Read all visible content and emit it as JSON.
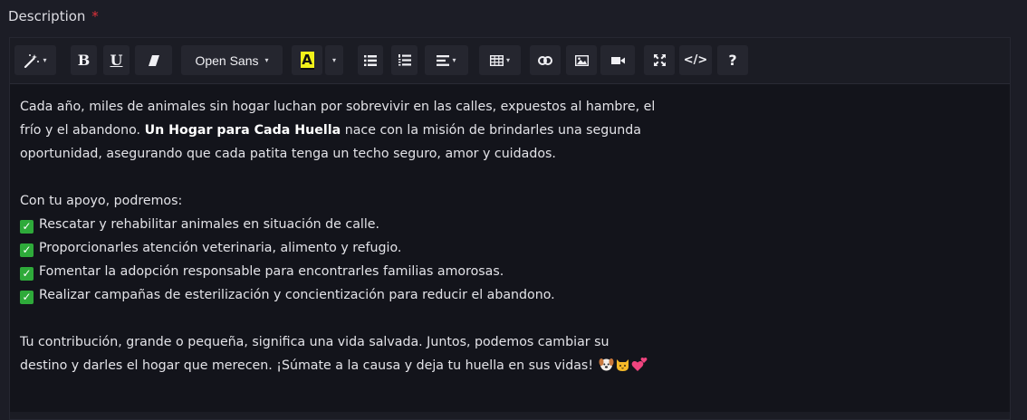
{
  "field": {
    "label": "Description",
    "required_mark": "*"
  },
  "toolbar": {
    "style_caret": "▾",
    "bold_label": "B",
    "underline_label": "U",
    "font_name": "Open Sans",
    "color_label": "A",
    "colors": {
      "highlight": "#f2f21a",
      "accent_required": "#e0323a"
    },
    "icons": [
      "magic-wand-icon",
      "bold-icon",
      "underline-icon",
      "eraser-icon",
      "font-family-dropdown",
      "text-color-icon",
      "bullet-list-icon",
      "numbered-list-icon",
      "align-icon",
      "table-icon",
      "link-icon",
      "picture-icon",
      "video-icon",
      "fullscreen-icon",
      "code-view-icon",
      "help-icon"
    ],
    "code_label": "</>",
    "help_label": "?"
  },
  "content": {
    "p1_line1": "Cada año, miles de animales sin hogar luchan por sobrevivir en las calles, expuestos al hambre, el",
    "p1_line2_a": "frío y el abandono. ",
    "p1_line2_bold": "Un Hogar para Cada Huella",
    "p1_line2_b": " nace con la misión de brindarles una segunda",
    "p1_line3": "oportunidad, asegurando que cada patita tenga un techo seguro, amor y cuidados.",
    "p2_intro": "Con tu apoyo, podremos:",
    "bullets": [
      "Rescatar y rehabilitar animales en situación de calle.",
      "Proporcionarles atención veterinaria, alimento y refugio.",
      "Fomentar la adopción responsable para encontrarles familias amorosas.",
      "Realizar campañas de esterilización y concientización para reducir el abandono."
    ],
    "p3_line1": "Tu contribución, grande o pequeña, significa una vida salvada. Juntos, podemos cambiar su",
    "p3_line2": "destino y darles el hogar que merecen. ¡Súmate a la causa y deja tu huella en sus vidas!"
  }
}
